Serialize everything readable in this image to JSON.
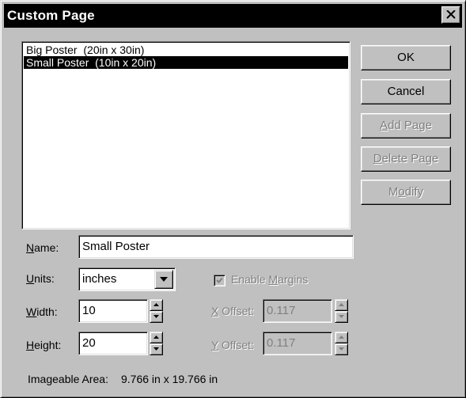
{
  "dialog": {
    "title": "Custom Page",
    "close_icon": "close-icon"
  },
  "pages_list": {
    "items": [
      {
        "label": "Big Poster  (20in x 30in)",
        "selected": false
      },
      {
        "label": "Small Poster  (10in x 20in)",
        "selected": true
      }
    ]
  },
  "buttons": {
    "ok": "OK",
    "cancel": "Cancel",
    "add_page": {
      "pre": "",
      "key": "A",
      "post": "dd Page"
    },
    "delete_page": {
      "pre": "",
      "key": "D",
      "post": "elete Page"
    },
    "modify": {
      "pre": "M",
      "key": "o",
      "post": "dify"
    }
  },
  "form": {
    "name": {
      "pre": "",
      "key": "N",
      "post": "ame:",
      "value": "Small Poster"
    },
    "units": {
      "pre": "",
      "key": "U",
      "post": "nits:",
      "value": "inches"
    },
    "width": {
      "pre": "",
      "key": "W",
      "post": "idth:",
      "value": "10"
    },
    "height": {
      "pre": "",
      "key": "H",
      "post": "eight:",
      "value": "20"
    },
    "enable_margins": {
      "pre": "Enable ",
      "key": "M",
      "post": "argins",
      "checked": true
    },
    "x_offset": {
      "pre": "",
      "key": "X",
      "post": " Offset:",
      "value": "0.117"
    },
    "y_offset": {
      "pre": "",
      "key": "Y",
      "post": " Offset:",
      "value": "0.117"
    },
    "imageable_area": {
      "label": "Imageable Area:",
      "value": "9.766 in x 19.766 in"
    }
  }
}
